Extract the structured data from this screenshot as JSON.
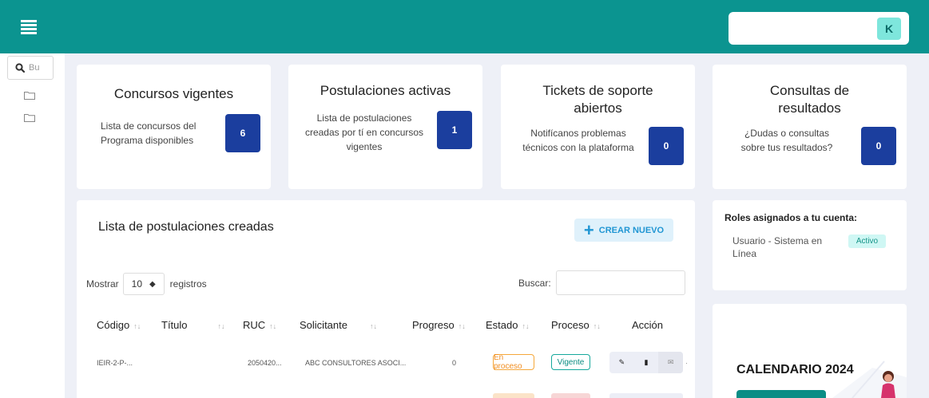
{
  "header": {
    "avatar_initial": "K"
  },
  "sidebar": {
    "search_placeholder": "Bu"
  },
  "stats": [
    {
      "title": "Concursos vigentes",
      "description": "Lista de concursos del Programa disponibles",
      "count": "6"
    },
    {
      "title": "Postulaciones activas",
      "description": "Lista de postulaciones creadas por tí en concursos vigentes",
      "count": "1"
    },
    {
      "title": "Tickets de soporte abiertos",
      "description": "Notifícanos problemas técnicos con la plataforma",
      "count": "0"
    },
    {
      "title": "Consultas de resultados",
      "description": "¿Dudas o consultas sobre tus resultados?",
      "count": "0"
    }
  ],
  "list": {
    "title": "Lista de postulaciones creadas",
    "create_label": "CREAR NUEVO",
    "show_label": "Mostrar",
    "page_size": "10",
    "records_label": "registros",
    "search_label": "Buscar:",
    "columns": [
      "Código",
      "Título",
      "RUC",
      "Solicitante",
      "Progreso",
      "Estado",
      "Proceso",
      "Acción"
    ],
    "rows": [
      {
        "codigo": "IEIR-2-P-...",
        "titulo": "",
        "ruc": "2050420...",
        "solicitante": "ABC CONSULTORES ASOCI...",
        "progreso": "0",
        "estado": "En proceso",
        "proceso": "Vigente"
      }
    ]
  },
  "roles": {
    "title": "Roles asignados a tu cuenta:",
    "items": [
      {
        "name": "Usuario - Sistema en Línea",
        "status": "Activo"
      }
    ]
  },
  "calendar": {
    "title": "CALENDARIO 2024"
  },
  "colors": {
    "header": "#0b9490",
    "badge": "#1b3e9e",
    "accent": "#2196d3"
  }
}
